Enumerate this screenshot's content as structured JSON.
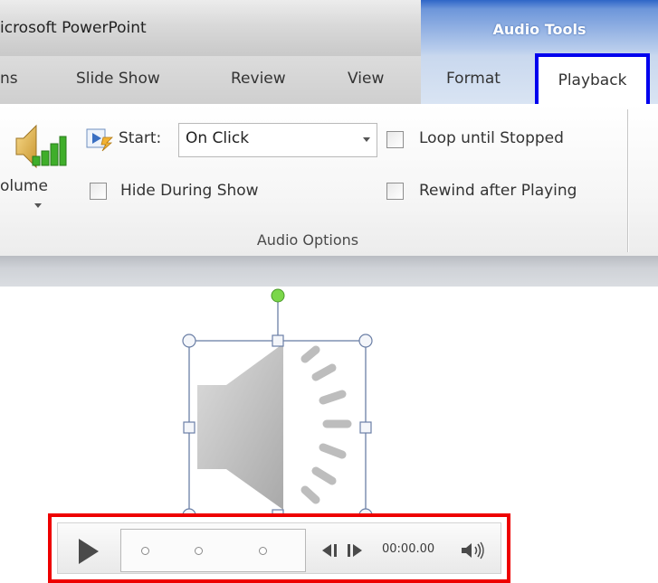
{
  "app": {
    "title": "icrosoft PowerPoint"
  },
  "ribbon_context": {
    "label": "Audio Tools"
  },
  "tabs": [
    {
      "label": "ns"
    },
    {
      "label": "Slide Show"
    },
    {
      "label": "Review"
    },
    {
      "label": "View"
    },
    {
      "label": "Format"
    },
    {
      "label": "Playback",
      "active": true
    }
  ],
  "audio_options": {
    "group_label": "Audio Options",
    "volume": {
      "label": "olume",
      "icon": "speaker-volume-icon"
    },
    "start": {
      "label": "Start:",
      "selected": "On Click",
      "icon": "start-play-icon"
    },
    "checkboxes": [
      {
        "label": "Hide During Show",
        "checked": false
      },
      {
        "label": "Loop until Stopped",
        "checked": false
      },
      {
        "label": "Rewind after Playing",
        "checked": false
      }
    ]
  },
  "player": {
    "time": "00:00.00",
    "icons": [
      "play-icon",
      "skip-back-icon",
      "skip-forward-icon",
      "volume-icon"
    ]
  },
  "colors": {
    "context_accent": "#2f66c7",
    "playback_tab_highlight": "#0000ee",
    "player_highlight": "#ee0000",
    "rotation_handle": "#7bd74a"
  }
}
